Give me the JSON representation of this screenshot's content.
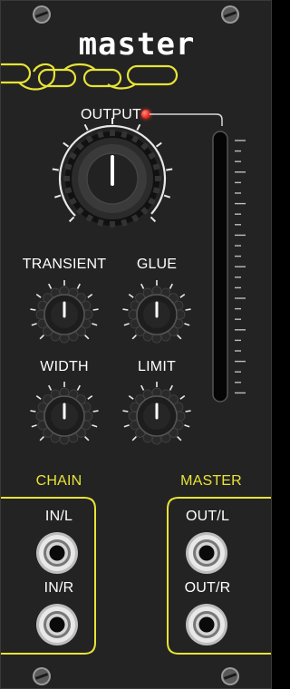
{
  "module": {
    "title": "master"
  },
  "labels": {
    "output": "OUTPUT",
    "transient": "TRANSIENT",
    "glue": "GLUE",
    "width": "WIDTH",
    "limit": "LIMIT",
    "chain": "CHAIN",
    "master": "MASTER",
    "in_l": "IN/L",
    "in_r": "IN/R",
    "out_l": "OUT/L",
    "out_r": "OUT/R"
  },
  "controls": {
    "output_knob": {
      "value": 0.5
    },
    "transient_knob": {
      "value": 0.5
    },
    "glue_knob": {
      "value": 0.5
    },
    "width_knob": {
      "value": 0.5
    },
    "limit_knob": {
      "value": 0.5
    }
  },
  "indicators": {
    "output_led": {
      "state": "on",
      "color": "#e8281c"
    },
    "level_meter": {
      "level": 0.0
    }
  },
  "colors": {
    "panel": "#232323",
    "accent_yellow": "#e8e337",
    "text": "#ffffff"
  }
}
